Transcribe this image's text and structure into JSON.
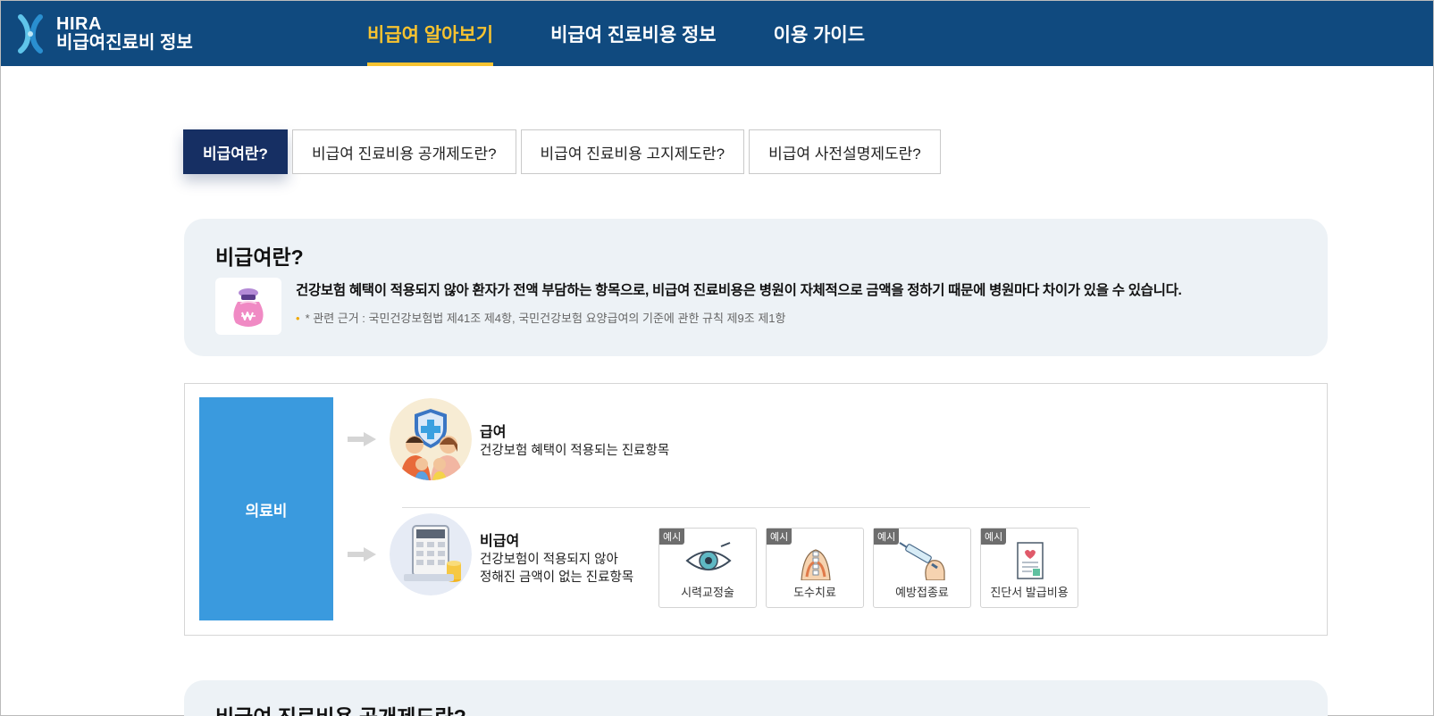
{
  "header": {
    "logo_line1": "HIRA",
    "logo_line2": "비급여진료비 정보",
    "nav": [
      {
        "label": "비급여 알아보기",
        "active": true
      },
      {
        "label": "비급여 진료비용 정보",
        "active": false
      },
      {
        "label": "이용 가이드",
        "active": false
      }
    ]
  },
  "tabs": [
    {
      "label": "비급여란?",
      "active": true
    },
    {
      "label": "비급여 진료비용 공개제도란?",
      "active": false
    },
    {
      "label": "비급여 진료비용 고지제도란?",
      "active": false
    },
    {
      "label": "비급여 사전설명제도란?",
      "active": false
    }
  ],
  "definition": {
    "title": "비급여란?",
    "icon": "money-bag-icon",
    "description": "건강보험 혜택이 적용되지 않아 환자가 전액 부담하는 항목으로, 비급여 진료비용은 병원이 자체적으로 금액을 정하기 때문에 병원마다 차이가 있을 수 있습니다.",
    "note": "* 관련 근거 : 국민건강보험법 제41조 제4항, 국민건강보험 요양급여의 기준에 관한 규칙 제9조 제1항"
  },
  "diagram": {
    "root_label": "의료비",
    "covered": {
      "title": "급여",
      "description": "건강보험 혜택이 적용되는 진료항목",
      "icon": "family-shield-icon"
    },
    "non_covered": {
      "title": "비급여",
      "description_line1": "건강보험이 적용되지 않아",
      "description_line2": "정해진 금액이 없는 진료항목",
      "icon": "calculator-icon"
    },
    "example_badge": "예시",
    "examples": [
      {
        "label": "시력교정술",
        "icon": "eye-icon"
      },
      {
        "label": "도수치료",
        "icon": "spine-therapy-icon"
      },
      {
        "label": "예방접종료",
        "icon": "syringe-icon"
      },
      {
        "label": "진단서 발급비용",
        "icon": "certificate-icon"
      }
    ]
  },
  "next_section": {
    "title": "비급여 진료비용 공개제도란?"
  },
  "colors": {
    "header_bg": "#104a7f",
    "accent": "#f7c330",
    "active_tab": "#162f63",
    "panel_bg": "#edf2f6",
    "medical_box": "#3a9ade"
  }
}
